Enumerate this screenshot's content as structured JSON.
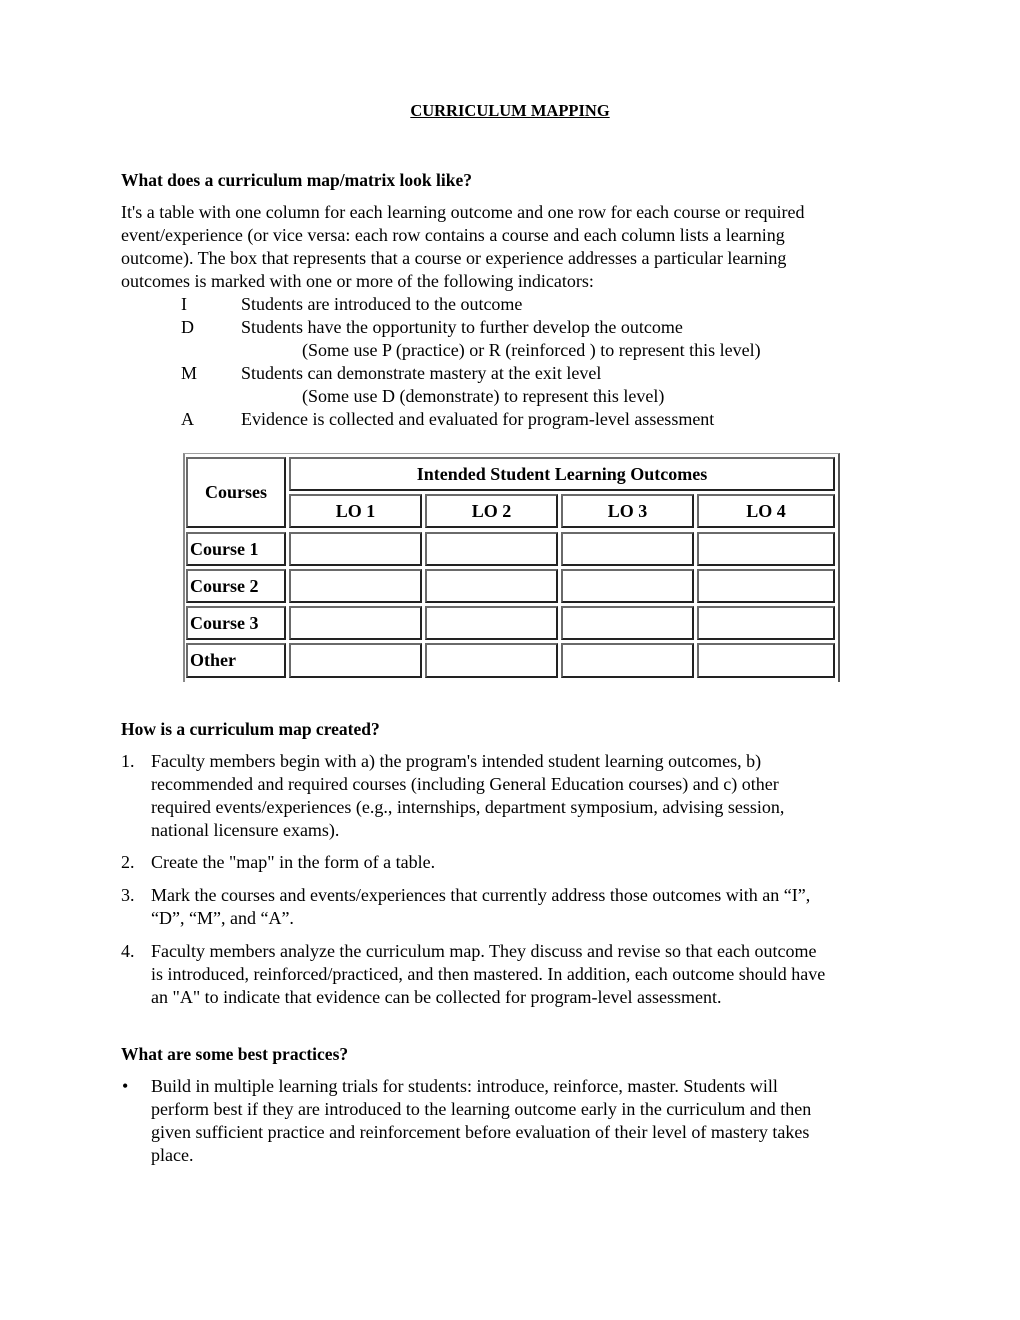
{
  "title": "CURRICULUM MAPPING",
  "section1": {
    "heading": "What does a curriculum map/matrix look like?",
    "para_lines": [
      "It's a table with one column for each learning outcome and one row for each course or required",
      "event/experience (or vice versa: each row contains a course and each column lists a learning",
      "outcome).  The box that represents that a course or experience addresses a particular learning",
      "outcomes is marked with one or more of the following indicators:"
    ],
    "indicators": [
      {
        "code": "I",
        "text": "Students are introduced to the outcome"
      },
      {
        "code": "D",
        "text": "Students have the opportunity to further develop the outcome",
        "note": "(Some use P (practice) or R (reinforced ) to represent this level)"
      },
      {
        "code": "M",
        "text": "Students can demonstrate mastery at the exit level",
        "note": "(Some use D (demonstrate) to represent this level)"
      },
      {
        "code": "A",
        "text": "Evidence is collected and evaluated for program-level assessment"
      }
    ]
  },
  "table": {
    "row_header": "Courses",
    "group_header": "Intended Student Learning Outcomes",
    "columns": [
      "LO 1",
      "LO 2",
      "LO 3",
      "LO 4"
    ],
    "rows": [
      {
        "label": "Course 1",
        "cells": [
          "",
          "",
          "",
          ""
        ]
      },
      {
        "label": "Course 2",
        "cells": [
          "",
          "",
          "",
          ""
        ]
      },
      {
        "label": "Course 3",
        "cells": [
          "",
          "",
          "",
          ""
        ]
      },
      {
        "label": "Other",
        "cells": [
          "",
          "",
          "",
          ""
        ]
      }
    ]
  },
  "section2": {
    "heading": "How is a curriculum map created?",
    "steps": [
      {
        "num": "1.",
        "lines": [
          "Faculty members begin with a) the program's intended student learning outcomes, b)",
          "recommended and required courses (including General Education courses) and c) other",
          "required events/experiences (e.g., internships, department symposium, advising session,",
          "national licensure exams)."
        ]
      },
      {
        "num": "2.",
        "lines": [
          "Create the \"map\" in the form of a table."
        ]
      },
      {
        "num": "3.",
        "lines": [
          "Mark the courses and events/experiences that currently address those outcomes with an “I”,",
          "“D”, “M”, and “A”."
        ]
      },
      {
        "num": "4.",
        "lines": [
          "Faculty members analyze the curriculum map. They discuss and revise so that each outcome",
          "is introduced, reinforced/practiced, and then mastered. In addition, each outcome should have",
          "an \"A\" to indicate that evidence can be collected for program-level assessment."
        ]
      }
    ]
  },
  "section3": {
    "heading": "What are some best practices?",
    "bullet_symbol": "•",
    "bullets": [
      {
        "lines": [
          "Build in multiple learning trials for students: introduce, reinforce, master. Students will",
          "perform best if they are introduced to the learning outcome early in the curriculum and then",
          "given sufficient practice and reinforcement before evaluation of their level of mastery takes",
          "place."
        ]
      }
    ]
  }
}
